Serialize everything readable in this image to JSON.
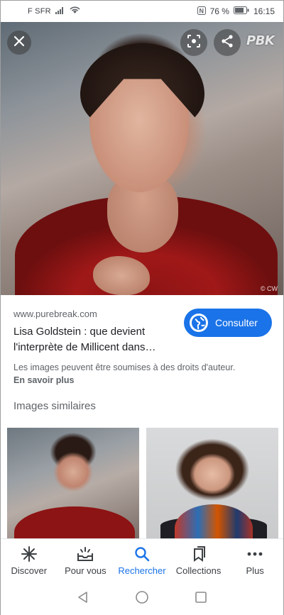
{
  "status_bar": {
    "carrier": "F SFR",
    "battery_text": "76 %",
    "time": "16:15"
  },
  "hero": {
    "watermark": "PBK",
    "copyright": "© CW",
    "buttons": {
      "close_icon": "close-icon",
      "lens_icon": "lens-icon",
      "share_icon": "share-icon"
    }
  },
  "result": {
    "domain": "www.purebreak.com",
    "title": "Lisa Goldstein : que devient l'interprète de Millicent dans…",
    "consult_label": "Consulter",
    "copyright_notice": "Les images peuvent être soumises à des droits d'auteur.",
    "learn_more": "En savoir plus"
  },
  "similar": {
    "heading": "Images similaires"
  },
  "bottom_nav": {
    "items": [
      {
        "label": "Discover",
        "icon": "asterisk-icon"
      },
      {
        "label": "Pour vous",
        "icon": "inbox-icon"
      },
      {
        "label": "Rechercher",
        "icon": "search-icon"
      },
      {
        "label": "Collections",
        "icon": "collections-icon"
      },
      {
        "label": "Plus",
        "icon": "more-icon"
      }
    ],
    "active_index": 2
  },
  "colors": {
    "accent": "#1a73e8",
    "text_secondary": "#5f6368"
  }
}
